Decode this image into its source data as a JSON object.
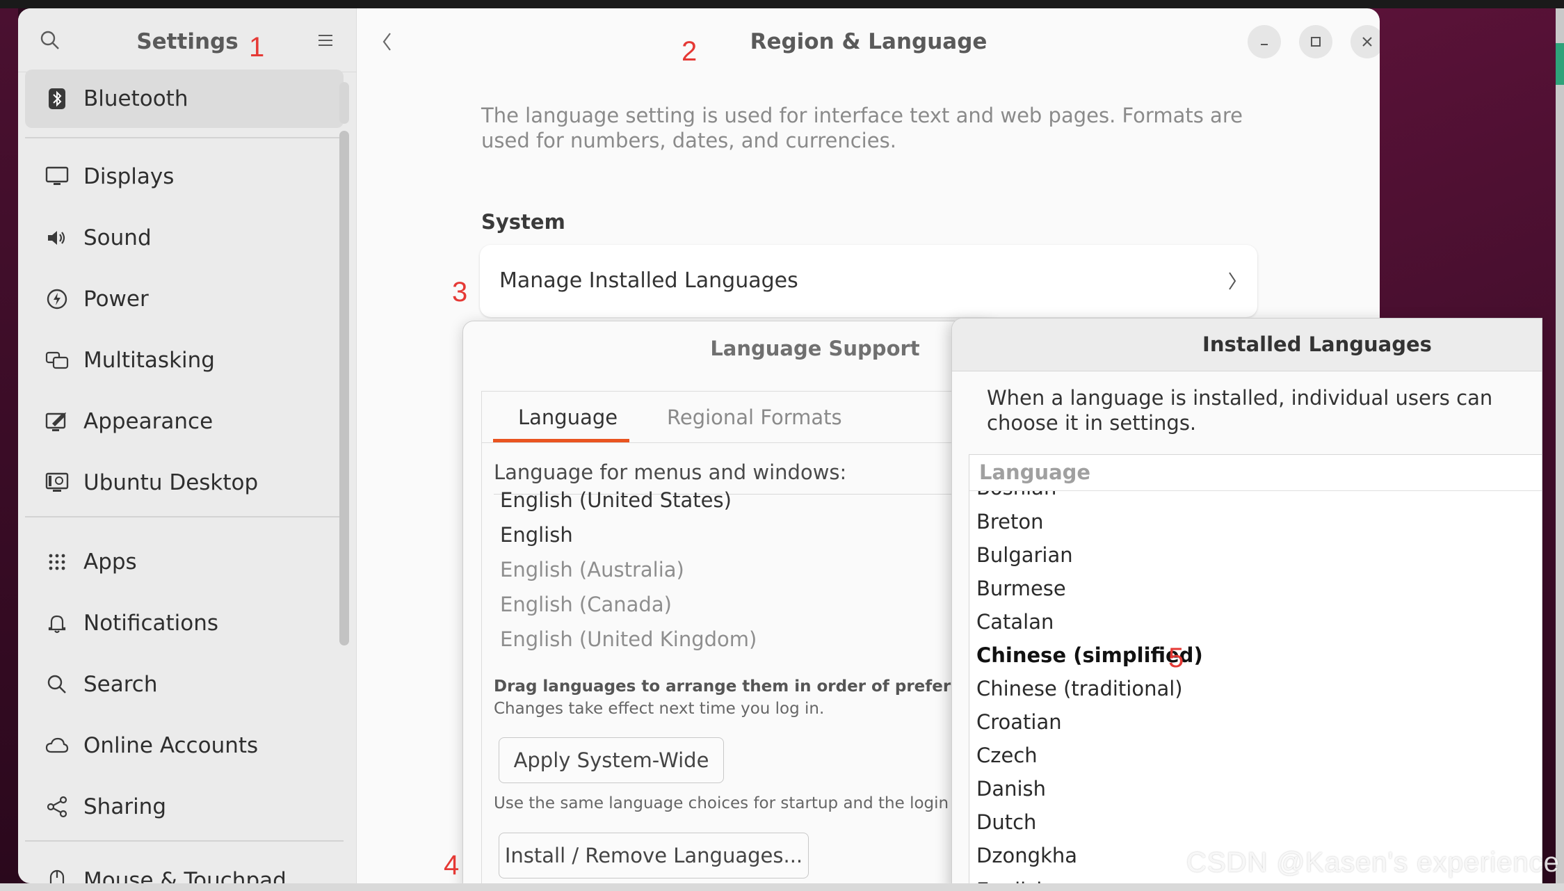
{
  "settings": {
    "title": "Settings",
    "sidebar": {
      "items": [
        {
          "label": "Bluetooth",
          "icon": "bluetooth-icon"
        },
        {
          "label": "Displays",
          "icon": "display-icon"
        },
        {
          "label": "Sound",
          "icon": "speaker-icon"
        },
        {
          "label": "Power",
          "icon": "power-icon"
        },
        {
          "label": "Multitasking",
          "icon": "multitasking-icon"
        },
        {
          "label": "Appearance",
          "icon": "appearance-icon"
        },
        {
          "label": "Ubuntu Desktop",
          "icon": "ubuntu-desktop-icon"
        },
        {
          "label": "Apps",
          "icon": "apps-grid-icon"
        },
        {
          "label": "Notifications",
          "icon": "bell-icon"
        },
        {
          "label": "Search",
          "icon": "search-icon"
        },
        {
          "label": "Online Accounts",
          "icon": "cloud-icon"
        },
        {
          "label": "Sharing",
          "icon": "share-icon"
        },
        {
          "label": "Mouse & Touchpad",
          "icon": "mouse-icon"
        }
      ]
    }
  },
  "region": {
    "title": "Region & Language",
    "description": "The language setting is used for interface text and web pages. Formats are used for numbers, dates, and currencies.",
    "section": "System",
    "manage_label": "Manage Installed Languages"
  },
  "annotations": [
    "1",
    "2",
    "3",
    "4",
    "5"
  ],
  "language_support": {
    "title": "Language Support",
    "tabs": [
      "Language",
      "Regional Formats"
    ],
    "menus_label": "Language for menus and windows:",
    "languages": [
      "English (United States)",
      "English",
      "English (Australia)",
      "English (Canada)",
      "English (United Kingdom)"
    ],
    "drag_note": "Drag languages to arrange them in order of preference.",
    "effect_note": "Changes take effect next time you log in.",
    "apply_button": "Apply System-Wide",
    "apply_note": "Use the same language choices for startup and the login scr",
    "install_button": "Install / Remove Languages..."
  },
  "installed_languages": {
    "title": "Installed Languages",
    "description": "When a language is installed, individual users can choose it in settings.",
    "column_header": "Language",
    "items": [
      "Bosnian",
      "Breton",
      "Bulgarian",
      "Burmese",
      "Catalan",
      "Chinese (simplified)",
      "Chinese (traditional)",
      "Croatian",
      "Czech",
      "Danish",
      "Dutch",
      "Dzongkha",
      "English"
    ]
  },
  "watermark": "CSDN @Kasen's experience",
  "colors": {
    "accent": "#e95420",
    "annotation": "#e53935"
  }
}
